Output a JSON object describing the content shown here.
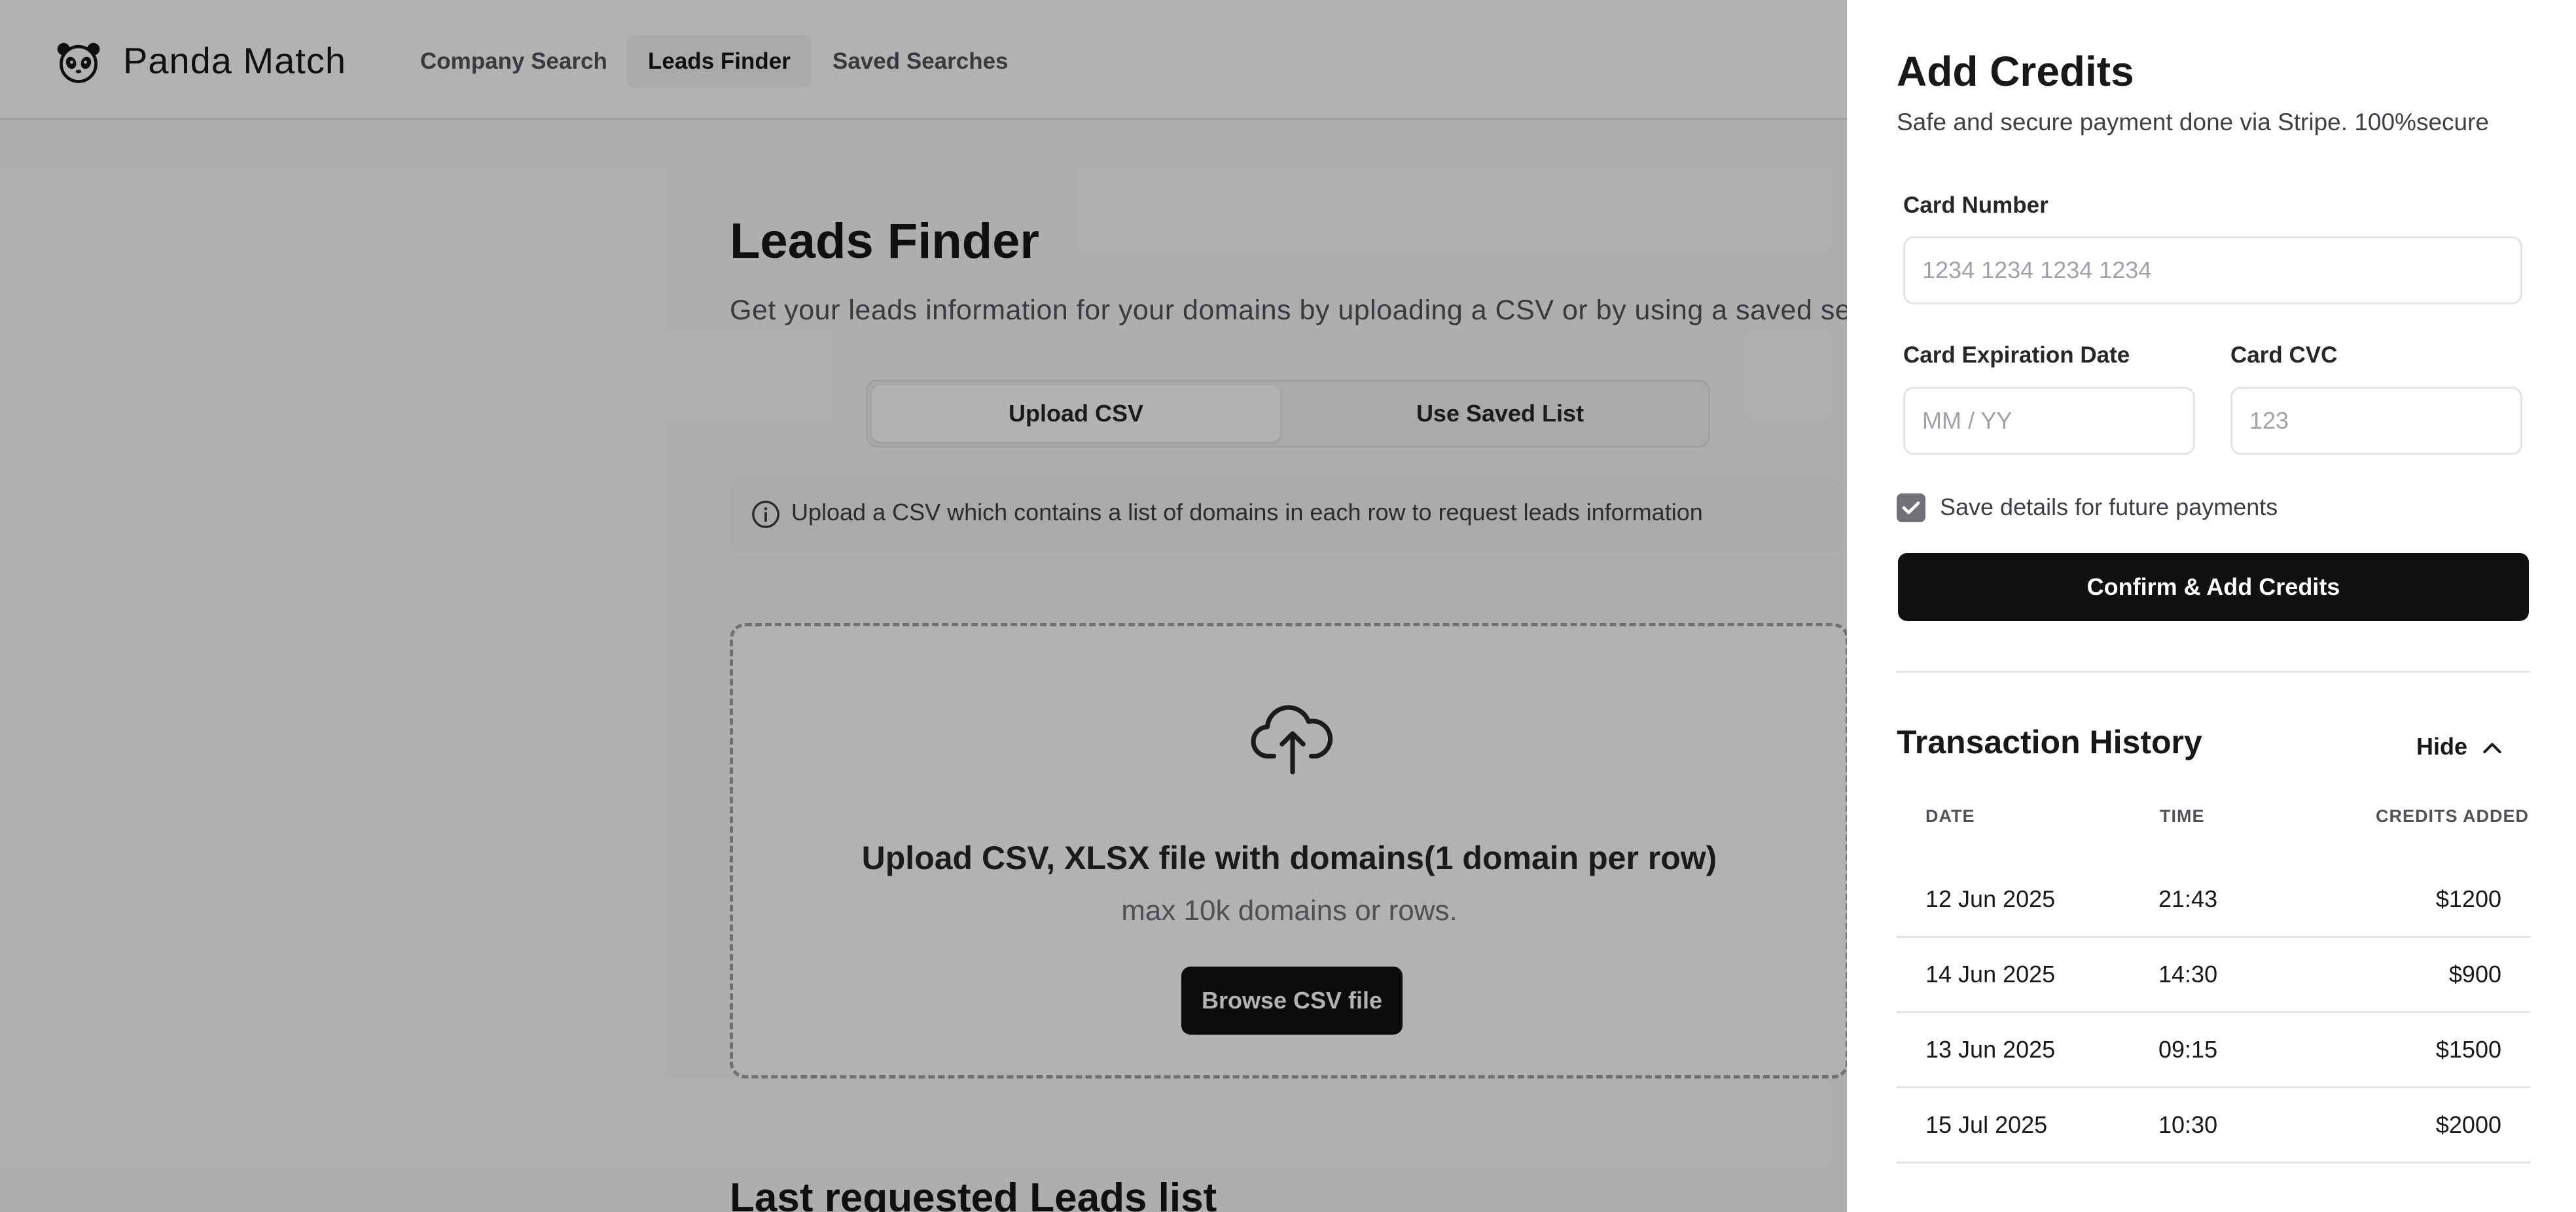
{
  "header": {
    "brand": "Panda Match",
    "nav": [
      {
        "label": "Company Search"
      },
      {
        "label": "Leads Finder"
      },
      {
        "label": "Saved Searches"
      }
    ]
  },
  "main": {
    "title": "Leads Finder",
    "subtitle": "Get your leads information for your domains by uploading a CSV or by using a saved search",
    "toggle": [
      "Upload CSV",
      "Use Saved List"
    ],
    "info": "Upload a CSV which contains a list of domains in each row to request leads information",
    "upload": {
      "title": "Upload CSV, XLSX file with domains(1 domain per row)",
      "subtitle": "max 10k domains or rows.",
      "button": "Browse CSV file"
    },
    "section_title": "Last requested Leads list"
  },
  "drawer": {
    "title": "Add Credits",
    "subtitle": "Safe and secure payment done via Stripe. 100%secure",
    "card_number": {
      "label": "Card Number",
      "placeholder": "1234 1234 1234 1234"
    },
    "card_expiry": {
      "label": "Card Expiration Date",
      "placeholder": "MM / YY"
    },
    "card_cvc": {
      "label": "Card CVC",
      "placeholder": "123"
    },
    "save_details": "Save details for future payments",
    "confirm_button": "Confirm & Add Credits",
    "history": {
      "title": "Transaction History",
      "toggle": "Hide",
      "columns": [
        "DATE",
        "TIME",
        "CREDITS ADDED"
      ],
      "rows": [
        {
          "date": "12 Jun 2025",
          "time": "21:43",
          "credits": "$1200"
        },
        {
          "date": "14 Jun 2025",
          "time": "14:30",
          "credits": "$900"
        },
        {
          "date": "13 Jun 2025",
          "time": "09:15",
          "credits": "$1500"
        },
        {
          "date": "15 Jul 2025",
          "time": "10:30",
          "credits": "$2000"
        }
      ]
    }
  }
}
